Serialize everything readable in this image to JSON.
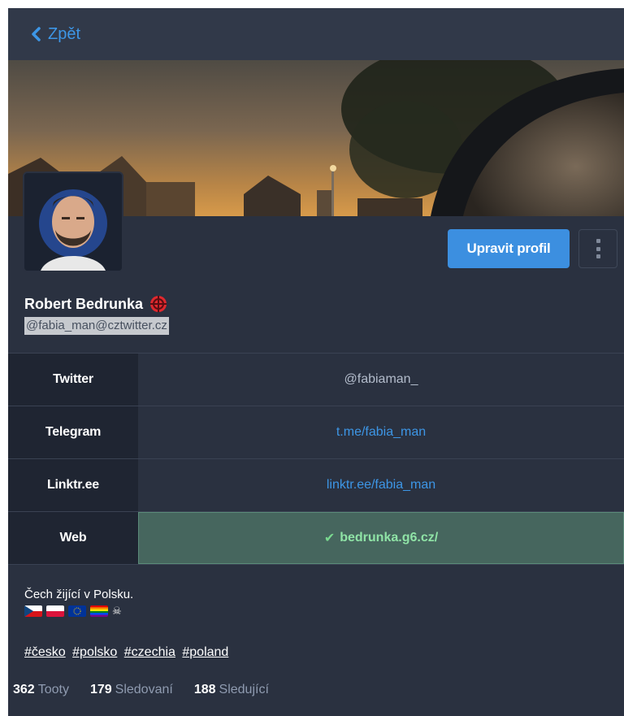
{
  "nav": {
    "back_label": "Zpět"
  },
  "profile": {
    "display_name": "Robert Bedrunka",
    "handle": "@fabia_man@cztwitter.cz",
    "edit_button": "Upravit profil",
    "fields": [
      {
        "name": "Twitter",
        "value": "@fabiaman_",
        "link": false,
        "verified": false
      },
      {
        "name": "Telegram",
        "value": "t.me/fabia_man",
        "link": true,
        "verified": false
      },
      {
        "name": "Linktr.ee",
        "value": "linktr.ee/fabia_man",
        "link": true,
        "verified": false
      },
      {
        "name": "Web",
        "value": "bedrunka.g6.cz/",
        "link": true,
        "verified": true
      }
    ],
    "bio": "Čech žijící v Polsku.",
    "hashtags": [
      "#česko",
      "#polsko",
      "#czechia",
      "#poland"
    ],
    "stats": {
      "toots_count": "362",
      "toots_label": "Tooty",
      "following_count": "179",
      "following_label": "Sledovaní",
      "followers_count": "188",
      "followers_label": "Sledující"
    }
  },
  "colors": {
    "accent": "#3c8fe0",
    "link": "#3d96e6",
    "background": "#2a3140",
    "verified_bg": "#46665e"
  }
}
